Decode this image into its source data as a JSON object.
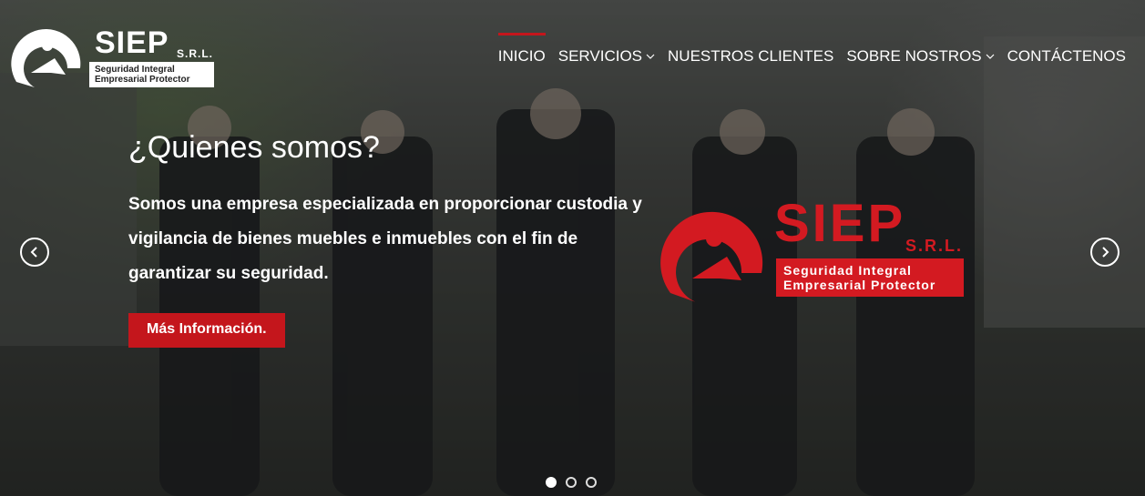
{
  "header": {
    "logo_text": "SIEP",
    "logo_suffix": "S.R.L.",
    "logo_tagline_1": "Seguridad Integral",
    "logo_tagline_2": "Empresarial Protector"
  },
  "nav": {
    "items": [
      {
        "label": "INICIO",
        "active": true
      },
      {
        "label": "SERVICIOS",
        "dropdown": true
      },
      {
        "label": "NUESTROS CLIENTES"
      },
      {
        "label": "SOBRE NOSTROS",
        "dropdown": true
      },
      {
        "label": "CONTÁCTENOS"
      }
    ]
  },
  "hero": {
    "title": "¿Quienes somos?",
    "description": "Somos una empresa especializada en proporcionar custodia y vigilancia de bienes muebles e inmuebles con el fin de garantizar su seguridad.",
    "button_label": "Más Información.",
    "brand_text": "SIEP",
    "brand_suffix": "S.R.L.",
    "brand_tagline_1": "Seguridad Integral",
    "brand_tagline_2": "Empresarial Protector"
  },
  "carousel": {
    "slide_count": 3,
    "active_slide": 1,
    "prev_icon": "chevron-left-icon",
    "next_icon": "chevron-right-icon"
  },
  "colors": {
    "accent": "#c4161c",
    "brand_red": "#d31a21",
    "text": "#ffffff"
  }
}
